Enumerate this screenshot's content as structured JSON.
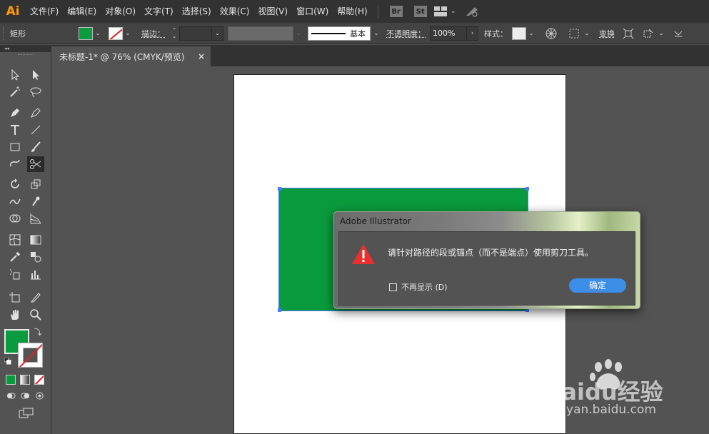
{
  "app": {
    "logo": "Ai"
  },
  "menu": {
    "items": [
      "文件(F)",
      "编辑(E)",
      "对象(O)",
      "文字(T)",
      "选择(S)",
      "效果(C)",
      "视图(V)",
      "窗口(W)",
      "帮助(H)"
    ],
    "badges": [
      "Br",
      "St"
    ]
  },
  "control": {
    "selection_label": "矩形",
    "fill_color": "#0a9a40",
    "stroke_label": "描边：",
    "stroke_profile": "基本",
    "opacity_label": "不透明度：",
    "opacity_value": "100%",
    "style_label": "样式：",
    "transform_label": "变换"
  },
  "tab": {
    "title": "未标题-1* @ 76% (CMYK/预览)",
    "close": "×"
  },
  "tools_panel": {
    "collapse": "◂◂",
    "active_tool": "scissors-tool"
  },
  "canvas": {
    "rect_color": "#0a9a3e"
  },
  "dialog": {
    "title": "Adobe Illustrator",
    "message": "请针对路径的段或锚点（而不是端点）使用剪刀工具。",
    "checkbox_label": "不再显示 (D)",
    "ok_label": "确定"
  },
  "watermark": {
    "brand": "Baidu经验",
    "url": "jingyan.baidu.com"
  }
}
